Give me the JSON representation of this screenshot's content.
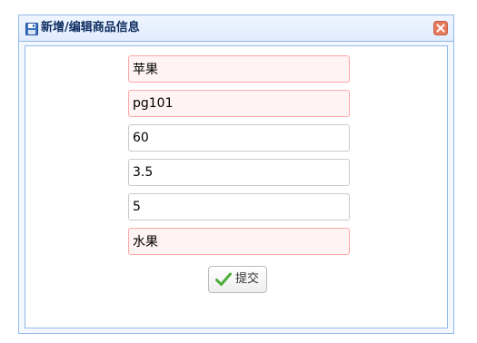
{
  "dialog": {
    "title": "新增/编辑商品信息",
    "title_icon": "save-icon",
    "close_icon": "close-icon"
  },
  "form": {
    "fields": [
      {
        "value": "苹果",
        "invalid": true
      },
      {
        "value": "pg101",
        "invalid": true
      },
      {
        "value": "60",
        "invalid": false
      },
      {
        "value": "3.5",
        "invalid": false
      },
      {
        "value": "5",
        "invalid": false
      },
      {
        "value": "水果",
        "invalid": true
      }
    ],
    "submit_label": "提交",
    "submit_icon": "checkmark-icon"
  },
  "colors": {
    "border_accent": "#95b8e7",
    "invalid_background": "#fff3f3",
    "invalid_border": "#ffa8a8",
    "close_button": "#e57a5c",
    "check_green": "#4caf3a"
  }
}
